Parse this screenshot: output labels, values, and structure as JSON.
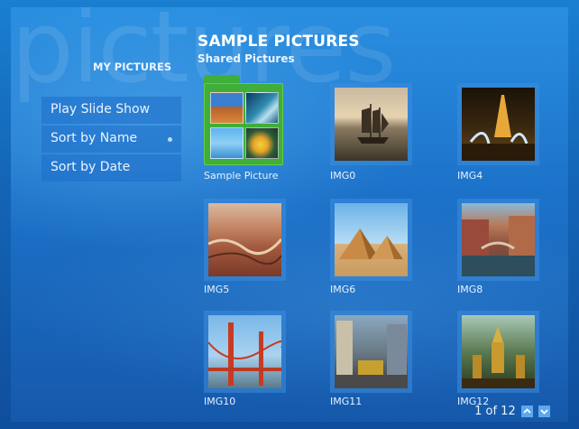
{
  "header": {
    "watermark": "pictures",
    "title": "SAMPLE PICTURES",
    "subtitle": "Shared Pictures",
    "section": "MY PICTURES"
  },
  "menu": {
    "items": [
      {
        "label": "Play Slide Show",
        "selected": false
      },
      {
        "label": "Sort by Name",
        "selected": true
      },
      {
        "label": "Sort by Date",
        "selected": false
      }
    ]
  },
  "grid": {
    "folder_label": "Sample Picture",
    "items": [
      {
        "label": "IMG0",
        "icon": "sailing-ship-image"
      },
      {
        "label": "IMG4",
        "icon": "eiffel-tower-fountain-image"
      },
      {
        "label": "IMG5",
        "icon": "canyon-image"
      },
      {
        "label": "IMG6",
        "icon": "pyramids-image"
      },
      {
        "label": "IMG8",
        "icon": "venice-canal-image"
      },
      {
        "label": "IMG10",
        "icon": "golden-gate-bridge-image"
      },
      {
        "label": "IMG11",
        "icon": "city-street-image"
      },
      {
        "label": "IMG12",
        "icon": "temple-statues-image"
      }
    ]
  },
  "pager": {
    "text": "1 of 12",
    "up_icon": "chevron-up-icon",
    "down_icon": "chevron-down-icon"
  },
  "colors": {
    "background": "#1c72c9",
    "menu_item": "#1e6ec8",
    "folder": "#3fae3a",
    "thumb_border": "#3c8cdc"
  }
}
